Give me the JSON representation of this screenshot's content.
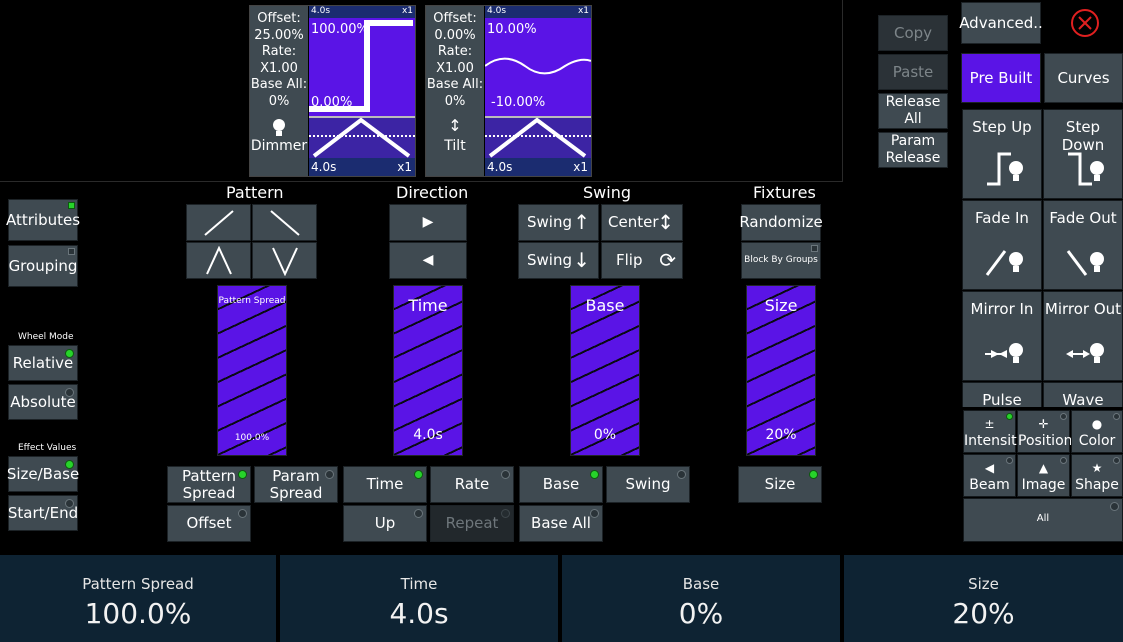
{
  "preview_1": {
    "offset_label": "Offset:",
    "offset": "25.00%",
    "rate_label": "Rate:",
    "rate": "X1.00",
    "base_label": "Base All:",
    "base": "0%",
    "param": "Dimmer",
    "top_time": "4.0s",
    "top_mult": "x1",
    "max_label": "100.00%",
    "min_label": "0.00%",
    "bottom_time": "4.0s",
    "bottom_mult": "x1"
  },
  "preview_2": {
    "offset_label": "Offset:",
    "offset": "0.00%",
    "rate_label": "Rate:",
    "rate": "X1.00",
    "base_label": "Base All:",
    "base": "0%",
    "param": "Tilt",
    "top_time": "4.0s",
    "top_mult": "x1",
    "max_label": "10.00%",
    "min_label": "-10.00%",
    "bottom_time": "4.0s",
    "bottom_mult": "x1"
  },
  "top_buttons": {
    "copy": "Copy",
    "paste": "Paste",
    "release_all": "Release All",
    "param_release": "Param Release",
    "advanced": "Advanced.."
  },
  "tabs": {
    "pre_built": "Pre Built",
    "curves": "Curves"
  },
  "left": {
    "attributes": "Attributes",
    "grouping": "Grouping",
    "wheel_mode_label": "Wheel Mode",
    "relative": "Relative",
    "absolute": "Absolute",
    "effect_values_label": "Effect Values",
    "size_base": "Size/Base",
    "start_end": "Start/End"
  },
  "sections": {
    "pattern": "Pattern",
    "direction": "Direction",
    "swing": "Swing",
    "fixtures": "Fixtures"
  },
  "swing_buttons": {
    "swing_up": "Swing",
    "center": "Center",
    "swing_down": "Swing",
    "flip": "Flip"
  },
  "fixtures_buttons": {
    "randomize": "Randomize",
    "block_by_groups": "Block By Groups"
  },
  "faders": [
    {
      "title": "Pattern Spread",
      "value": "100.0%"
    },
    {
      "title": "Time",
      "value": "4.0s"
    },
    {
      "title": "Base",
      "value": "0%"
    },
    {
      "title": "Size",
      "value": "20%"
    }
  ],
  "mode_buttons": {
    "pattern_spread": "Pattern Spread",
    "param_spread": "Param Spread",
    "offset": "Offset",
    "time": "Time",
    "rate": "Rate",
    "up": "Up",
    "repeat": "Repeat",
    "base": "Base",
    "swing": "Swing",
    "base_all": "Base All",
    "size": "Size"
  },
  "prebuilt": {
    "step_up": "Step Up",
    "step_down": "Step Down",
    "fade_in": "Fade In",
    "fade_out": "Fade Out",
    "mirror_in": "Mirror In",
    "mirror_out": "Mirror Out",
    "pulse": "Pulse",
    "wave": "Wave"
  },
  "categories": {
    "intensity": "Intensity",
    "position": "Position",
    "color": "Color",
    "beam": "Beam",
    "image": "Image",
    "shape": "Shape",
    "all": "All"
  },
  "bottom": [
    {
      "title": "Pattern Spread",
      "value": "100.0%"
    },
    {
      "title": "Time",
      "value": "4.0s"
    },
    {
      "title": "Base",
      "value": "0%"
    },
    {
      "title": "Size",
      "value": "20%"
    }
  ],
  "colors": {
    "accent": "#5a14e6",
    "button": "#3f4a51",
    "panel": "#0e2333",
    "led_on": "#27d32a",
    "close": "#e02020"
  }
}
